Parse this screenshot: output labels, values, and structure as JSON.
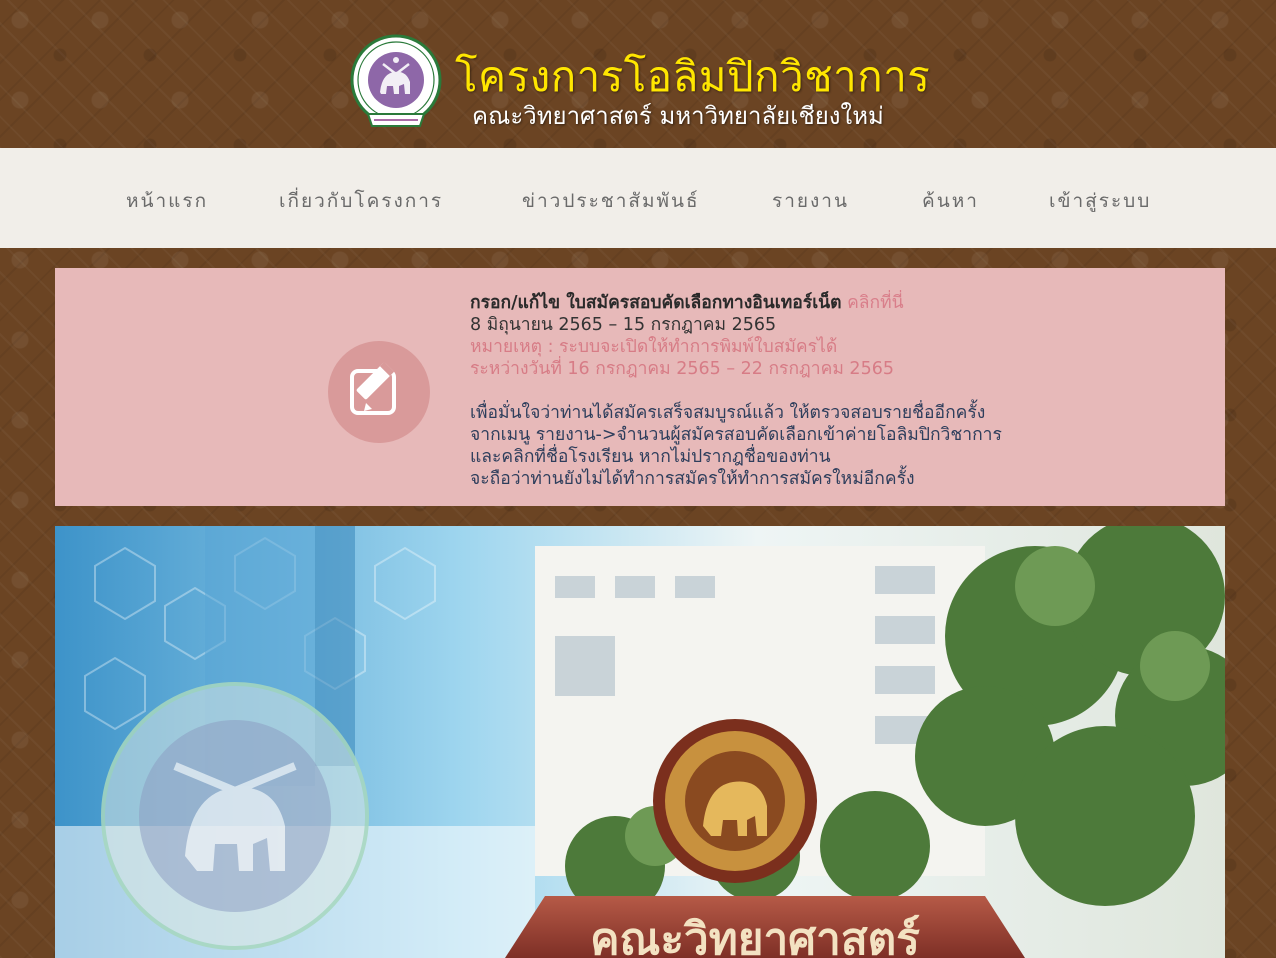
{
  "header": {
    "title": "โครงการโอลิมปิกวิชาการ",
    "subtitle": "คณะวิทยาศาสตร์ มหาวิทยาลัยเชียงใหม่",
    "logo_icon": "cmu-science-seal-logo"
  },
  "nav": {
    "items": [
      {
        "label": "หน้าแรก"
      },
      {
        "label": "เกี่ยวกับโครงการ"
      },
      {
        "label": "ข่าวประชาสัมพันธ์"
      },
      {
        "label": "รายงาน"
      },
      {
        "label": "ค้นหา"
      },
      {
        "label": "เข้าสู่ระบบ"
      }
    ]
  },
  "notice": {
    "icon": "edit-icon",
    "headline": "กรอก/แก้ไข ใบสมัครสอบคัดเลือกทางอินเทอร์เน็ต",
    "link_label": "คลิกที่นี่",
    "dates": "8 มิถุนายน 2565 – 15 กรกฎาคม 2565",
    "remark_line1": "หมายเหตุ : ระบบจะเปิดให้ทำการพิมพ์ใบสมัครได้",
    "remark_line2": "ระหว่างวันที่ 16 กรกฎาคม 2565 – 22 กรกฎาคม 2565",
    "info_line1": "เพื่อมั่นใจว่าท่านได้สมัครเสร็จสมบูรณ์แล้ว ให้ตรวจสอบรายชื่ออีกครั้ง",
    "info_line2": "จากเมนู รายงาน->จำนวนผู้สมัครสอบคัดเลือกเข้าค่ายโอลิมปิกวิชาการ",
    "info_line3": "และคลิกที่ชื่อโรงเรียน หากไม่ปรากฎชื่อของท่าน",
    "info_line4": "จะถือว่าท่านยังไม่ได้ทำการสมัครให้ทำการสมัครใหม่อีกครั้ง"
  },
  "banner": {
    "sign_text": "คณะวิทยาศาสตร์",
    "colors": {
      "sky": "#6fb8e0",
      "building": "#f2f2ee",
      "tree": "#4d7a3a",
      "sign": "#a3473a",
      "seal_gold": "#c8913e"
    }
  },
  "colors": {
    "background": "#6b4423",
    "title": "#ffe600",
    "navbar": "#f1eee9",
    "notice_bg": "#e7b9b9",
    "accent": "#d97e8a",
    "body_text": "#2e3e5c"
  }
}
